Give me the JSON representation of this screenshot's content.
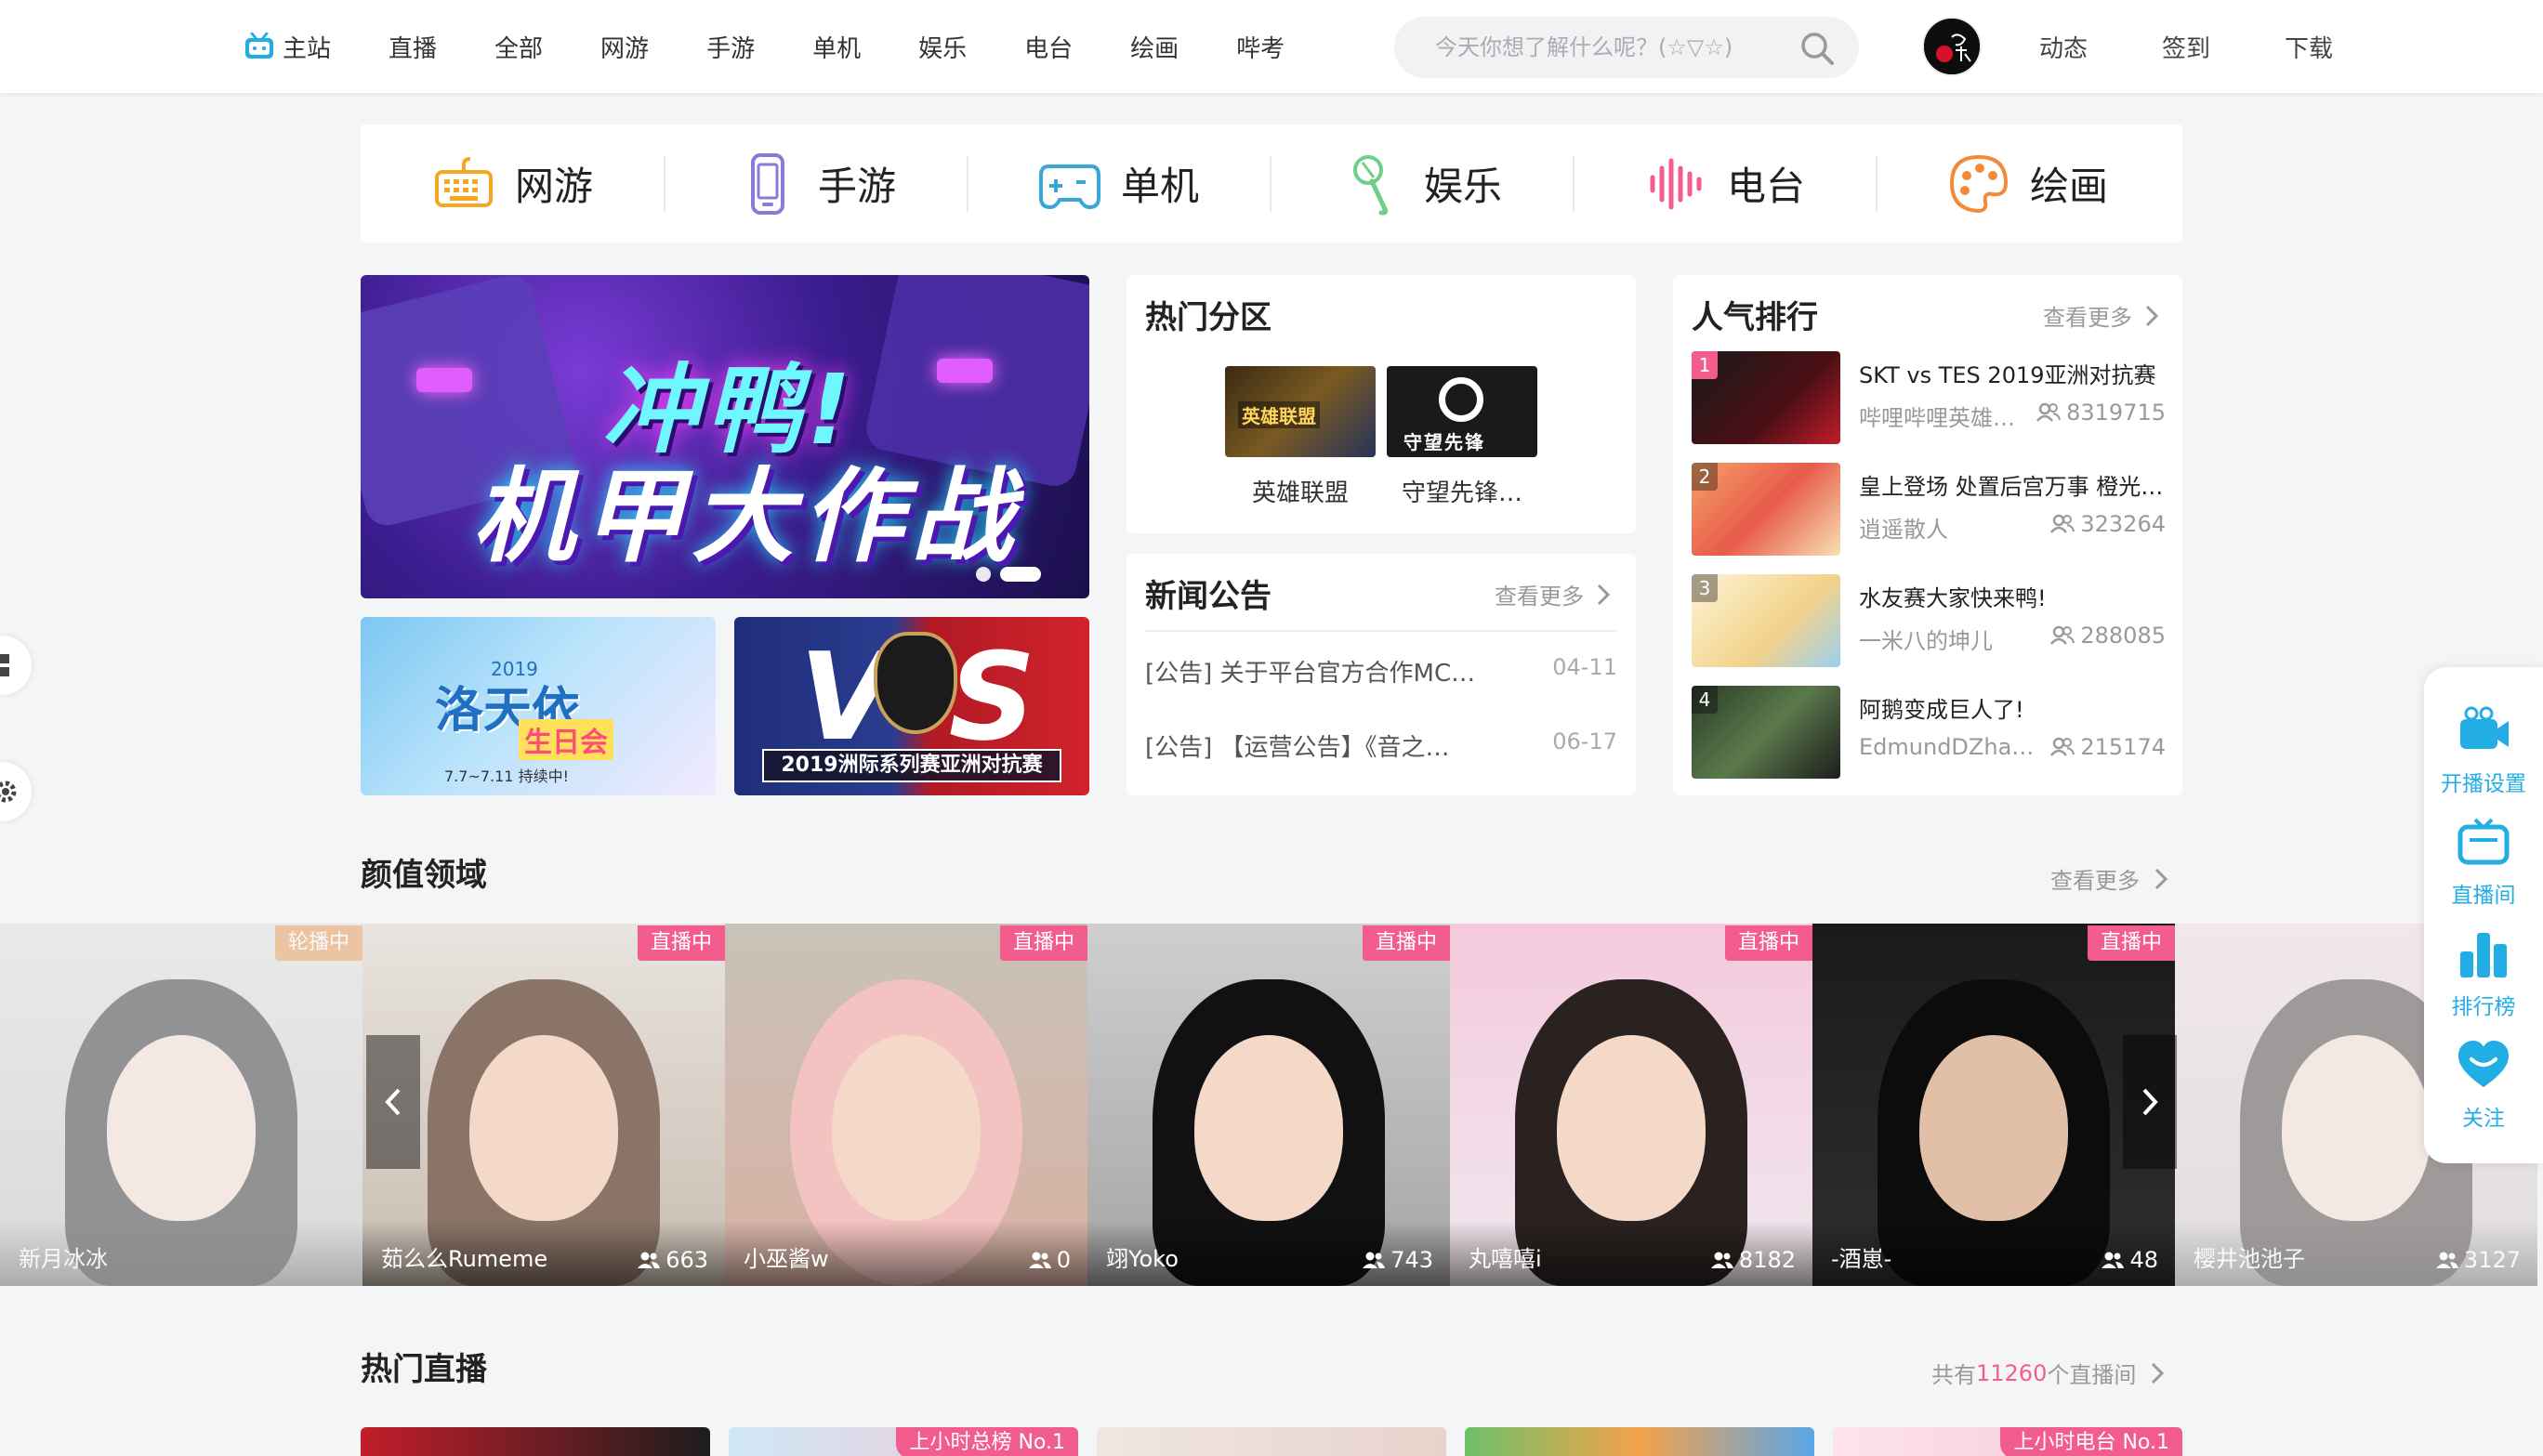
{
  "topnav": {
    "home": "主站",
    "items": [
      "直播",
      "全部",
      "网游",
      "手游",
      "单机",
      "娱乐",
      "电台",
      "绘画",
      "哔考"
    ]
  },
  "search": {
    "placeholder": "今天你想了解什么呢？(☆▽☆)"
  },
  "user_links": [
    "动态",
    "签到",
    "下载"
  ],
  "categories": [
    {
      "label": "网游",
      "icon": "keyboard-icon",
      "color": "#f5a623"
    },
    {
      "label": "手游",
      "icon": "phone-icon",
      "color": "#8a7bd8"
    },
    {
      "label": "单机",
      "icon": "gamepad-icon",
      "color": "#3aa6d8"
    },
    {
      "label": "娱乐",
      "icon": "microphone-icon",
      "color": "#6ccf8a"
    },
    {
      "label": "电台",
      "icon": "soundwave-icon",
      "color": "#f25d8e"
    },
    {
      "label": "绘画",
      "icon": "palette-icon",
      "color": "#f28a3a"
    }
  ],
  "banner": {
    "main_title_1": "冲鸭!",
    "main_title_2": "机甲大作战",
    "sub1_title": "洛天依",
    "sub1_year": "2019",
    "sub1_tag": "生日会",
    "sub1_date": "7.7~7.11 持续中!",
    "sub2_vs": "VS",
    "sub2_caption": "2019洲际系列赛亚洲对抗赛"
  },
  "hot_sections": {
    "title": "热门分区",
    "items": [
      "英雄联盟",
      "守望先锋…"
    ]
  },
  "news": {
    "title": "新闻公告",
    "more": "查看更多",
    "items": [
      {
        "text": "[公告] 关于平台官方合作MC…",
        "date": "04-11"
      },
      {
        "text": "[公告] 【运营公告】《音之…",
        "date": "06-17"
      }
    ]
  },
  "ranking": {
    "title": "人气排行",
    "more": "查看更多",
    "items": [
      {
        "rank": "1",
        "title": "SKT vs TES 2019亚洲对抗赛",
        "name": "哔哩哔哩英雄…",
        "count": "8319715"
      },
      {
        "rank": "2",
        "title": "皇上登场 处置后宫万事 橙光…",
        "name": "逍遥散人",
        "count": "323264"
      },
      {
        "rank": "3",
        "title": "水友赛大家快来鸭!",
        "name": "一米八的坤儿",
        "count": "288085"
      },
      {
        "rank": "4",
        "title": "阿鹅变成巨人了!",
        "name": "EdmundDZhang",
        "count": "215174"
      }
    ]
  },
  "beauty": {
    "title": "颜值领域",
    "more": "查看更多",
    "slides": [
      {
        "name": "新月冰冰",
        "count": "",
        "badge": "轮播中"
      },
      {
        "name": "茹么么Rumeme",
        "count": "663",
        "badge": "直播中"
      },
      {
        "name": "小巫酱w",
        "count": "0",
        "badge": "直播中"
      },
      {
        "name": "翊Yoko",
        "count": "743",
        "badge": "直播中"
      },
      {
        "name": "丸嘻嘻i",
        "count": "8182",
        "badge": "直播中"
      },
      {
        "name": "-酒崽-",
        "count": "48",
        "badge": "直播中"
      },
      {
        "name": "樱井池池子",
        "count": "3127",
        "badge": ""
      }
    ]
  },
  "hot_live": {
    "title": "热门直播",
    "total_prefix": "共有",
    "total": "11260",
    "total_suffix": "个直播间",
    "tags": [
      "上小时总榜 No.1",
      "上小时电台 No.1"
    ]
  },
  "side_panel": [
    "开播设置",
    "直播间",
    "排行榜",
    "关注"
  ],
  "colors": {
    "accent": "#23ade5",
    "pink": "#f25d8e",
    "bg": "#f4f5f7"
  }
}
